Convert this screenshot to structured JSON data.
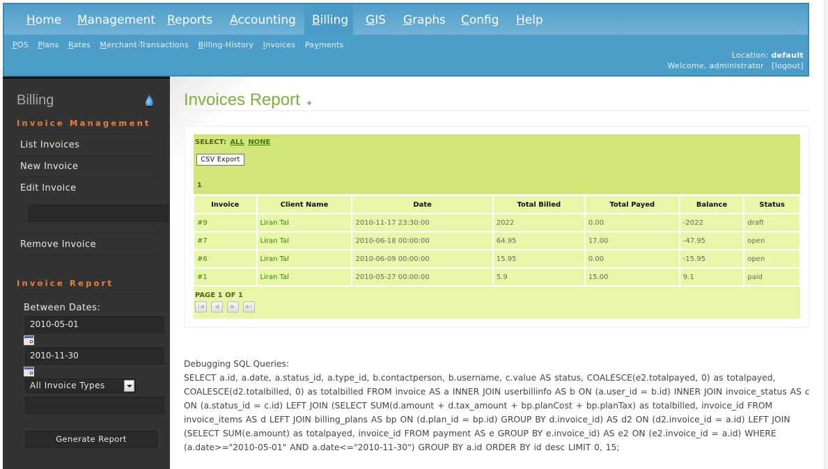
{
  "header": {
    "top_nav": [
      {
        "label": "Home",
        "accesskey_index": 0,
        "active": false
      },
      {
        "label": "Management",
        "accesskey_index": 0,
        "active": false
      },
      {
        "label": "Reports",
        "accesskey_index": 0,
        "active": false
      },
      {
        "label": "Accounting",
        "accesskey_index": 0,
        "active": false
      },
      {
        "label": "Billing",
        "accesskey_index": 0,
        "active": true
      },
      {
        "label": "GIS",
        "accesskey_index": 0,
        "active": false
      },
      {
        "label": "Graphs",
        "accesskey_index": 0,
        "active": false
      },
      {
        "label": "Config",
        "accesskey_index": 0,
        "active": false
      },
      {
        "label": "Help",
        "accesskey_index": 0,
        "active": false
      }
    ],
    "sub_nav": [
      "POS",
      "Plans",
      "Rates",
      "Merchant-Transactions",
      "Billing-History",
      "Invoices",
      "Payments"
    ],
    "location_label": "Location:",
    "location_value": "default",
    "welcome_text": "Welcome, administrator",
    "logout_label": "[logout]"
  },
  "sidebar": {
    "title": "Billing",
    "icon": "water-drop-icon",
    "sections": {
      "management": {
        "heading": "Invoice Management",
        "items": [
          "List Invoices",
          "New Invoice",
          "Edit Invoice",
          "Remove Invoice"
        ],
        "edit_input_value": ""
      },
      "report": {
        "heading": "Invoice Report",
        "between_dates_label": "Between Dates:",
        "start_date": "2010-05-01",
        "end_date": "2010-11-30",
        "invoice_type_selected": "All Invoice Types",
        "extra_input_value": "",
        "generate_button": "Generate Report"
      }
    }
  },
  "main": {
    "title": "Invoices Report",
    "title_marker": "+",
    "select_label": "SELECT:",
    "select_all": "ALL",
    "select_none": "NONE",
    "csv_export_label": "CSV Export",
    "page_count": "1",
    "table": {
      "columns": [
        "Invoice",
        "Client Name",
        "Date",
        "Total Billed",
        "Total Payed",
        "Balance",
        "Status"
      ],
      "rows": [
        [
          "#9",
          "Liran Tal",
          "2010-11-17 23:30:00",
          "2022",
          "0.00",
          "-2022",
          "draft"
        ],
        [
          "#7",
          "Liran Tal",
          "2010-06-18 00:00:00",
          "64.95",
          "17.00",
          "-47.95",
          "open"
        ],
        [
          "#6",
          "Liran Tal",
          "2010-06-09 00:00:00",
          "15.95",
          "0.00",
          "-15.95",
          "open"
        ],
        [
          "#1",
          "Liran Tal",
          "2010-05-27 00:00:00",
          "5.9",
          "15.00",
          "9.1",
          "paid"
        ]
      ]
    },
    "pager": {
      "text": "PAGE 1 OF 1",
      "buttons": [
        "first",
        "previous",
        "next",
        "last"
      ]
    },
    "debug": {
      "heading": "Debugging SQL Queries:",
      "sql": "SELECT a.id, a.date, a.status_id, a.type_id, b.contactperson, b.username, c.value AS status, COALESCE(e2.totalpayed, 0) as totalpayed, COALESCE(d2.totalbilled, 0) as totalbilled FROM invoice AS a INNER JOIN userbillinfo AS b ON (a.user_id = b.id) INNER JOIN invoice_status AS c ON (a.status_id = c.id) LEFT JOIN (SELECT SUM(d.amount + d.tax_amount + bp.planCost + bp.planTax) as totalbilled, invoice_id FROM invoice_items AS d LEFT JOIN billing_plans AS bp ON (d.plan_id = bp.id) GROUP BY d.invoice_id) AS d2 ON (d2.invoice_id = a.id) LEFT JOIN (SELECT SUM(e.amount) as totalpayed, invoice_id FROM payment AS e GROUP BY e.invoice_id) AS e2 ON (e2.invoice_id = a.id) WHERE (a.date>=\"2010-05-01\" AND a.date<=\"2010-11-30\") GROUP BY a.id ORDER BY id desc LIMIT 0, 15;"
    }
  },
  "colors": {
    "header_blue": "#4d9dc9",
    "sidebar_dark": "#333333",
    "section_orange": "#f07e3c",
    "title_green": "#7ab33a",
    "table_green": "#d1e676",
    "row_green": "#e7f7a7",
    "link_green": "#3b7d0e"
  }
}
